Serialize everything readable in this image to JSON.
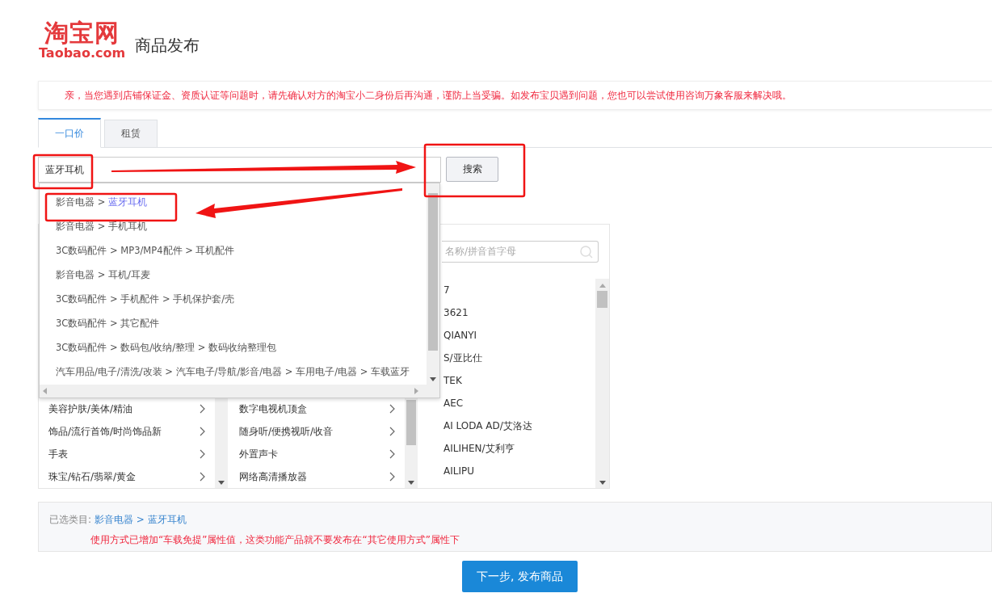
{
  "header": {
    "logo": "淘宝网",
    "logo_sub": "Taobao.com",
    "title": "商品发布"
  },
  "notice": "亲，当您遇到店铺保证金、资质认证等问题时，请先确认对方的淘宝小二身份后再沟通，谨防上当受骗。如发布宝贝遇到问题，您也可以尝试使用咨询万象客服来解决哦。",
  "tabs": [
    {
      "label": "一口价",
      "selected": true
    },
    {
      "label": "租赁",
      "selected": false
    }
  ],
  "search": {
    "value": "蓝牙耳机",
    "button": "搜索"
  },
  "suggestions": [
    {
      "prefix": "影音电器 > ",
      "leaf": "蓝牙耳机",
      "selected": true
    },
    {
      "prefix": "影音电器 > ",
      "leaf": "手机耳机",
      "selected": false
    },
    {
      "prefix": "3C数码配件 > MP3/MP4配件 > ",
      "leaf": "耳机配件",
      "selected": false
    },
    {
      "prefix": "影音电器 > ",
      "leaf": "耳机/耳麦",
      "selected": false
    },
    {
      "prefix": "3C数码配件 > 手机配件 > ",
      "leaf": "手机保护套/壳",
      "selected": false
    },
    {
      "prefix": "3C数码配件 > ",
      "leaf": "其它配件",
      "selected": false
    },
    {
      "prefix": "3C数码配件 > 数码包/收纳/整理 > ",
      "leaf": "数码收纳整理包",
      "selected": false
    },
    {
      "prefix": "汽车用品/电子/清洗/改装 > 汽车电子/导航/影音/电器 > 车用电子/电器 > ",
      "leaf": "车载蓝牙",
      "selected": false
    }
  ],
  "categories": {
    "column_1": [
      "美容护肤/美体/精油",
      "饰品/流行首饰/时尚饰品新",
      "手表",
      "珠宝/钻石/翡翠/黄金"
    ],
    "column_2": [
      "数字电视机顶盒",
      "随身听/便携视听/收音",
      "外置声卡",
      "网络高清播放器"
    ],
    "brands": {
      "placeholder": "名称/拼音首字母",
      "items": [
        "7",
        "3621",
        "QIANYI",
        "S/亚比仕",
        "TEK",
        "AEC",
        "AI LODA AD/艾洛达",
        "AILIHEN/艾利亨",
        "AILIPU"
      ]
    }
  },
  "selected_category": {
    "label": "已选类目:",
    "path": "影音电器 > 蓝牙耳机",
    "warning": "使用方式已增加“车载免提”属性值，这类功能产品就不要发布在“其它使用方式”属性下"
  },
  "next_button": "下一步, 发布商品"
}
